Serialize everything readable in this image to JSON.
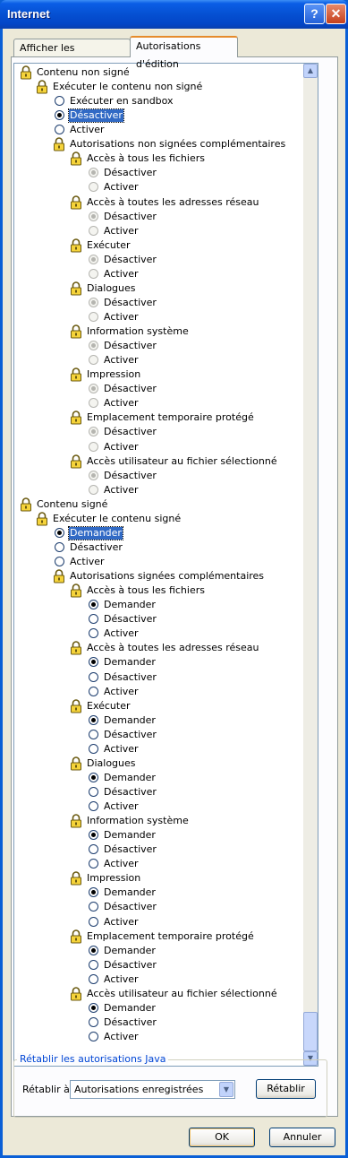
{
  "window": {
    "title": "Internet",
    "help_label": "?",
    "close_label": "✕"
  },
  "tabs": [
    {
      "label": "Afficher les autorisations",
      "active": false
    },
    {
      "label": "Autorisations d'édition",
      "active": true
    }
  ],
  "tree": [
    {
      "level": 0,
      "kind": "lock",
      "label": "Contenu non signé"
    },
    {
      "level": 1,
      "kind": "lock",
      "label": "Exécuter le contenu non signé"
    },
    {
      "level": 2,
      "kind": "radio",
      "label": "Exécuter en sandbox",
      "checked": false
    },
    {
      "level": 2,
      "kind": "radio",
      "label": "Désactiver",
      "checked": true,
      "selected": true
    },
    {
      "level": 2,
      "kind": "radio",
      "label": "Activer",
      "checked": false
    },
    {
      "level": 2,
      "kind": "lock",
      "label": "Autorisations non signées complémentaires"
    },
    {
      "level": 3,
      "kind": "lock",
      "label": "Accès à tous les fichiers"
    },
    {
      "level": 4,
      "kind": "radio",
      "label": "Désactiver",
      "checked": true,
      "disabled": true
    },
    {
      "level": 4,
      "kind": "radio",
      "label": "Activer",
      "checked": false,
      "disabled": true
    },
    {
      "level": 3,
      "kind": "lock",
      "label": "Accès à toutes les adresses réseau"
    },
    {
      "level": 4,
      "kind": "radio",
      "label": "Désactiver",
      "checked": true,
      "disabled": true
    },
    {
      "level": 4,
      "kind": "radio",
      "label": "Activer",
      "checked": false,
      "disabled": true
    },
    {
      "level": 3,
      "kind": "lock",
      "label": "Exécuter"
    },
    {
      "level": 4,
      "kind": "radio",
      "label": "Désactiver",
      "checked": true,
      "disabled": true
    },
    {
      "level": 4,
      "kind": "radio",
      "label": "Activer",
      "checked": false,
      "disabled": true
    },
    {
      "level": 3,
      "kind": "lock",
      "label": "Dialogues"
    },
    {
      "level": 4,
      "kind": "radio",
      "label": "Désactiver",
      "checked": true,
      "disabled": true
    },
    {
      "level": 4,
      "kind": "radio",
      "label": "Activer",
      "checked": false,
      "disabled": true
    },
    {
      "level": 3,
      "kind": "lock",
      "label": "Information système"
    },
    {
      "level": 4,
      "kind": "radio",
      "label": "Désactiver",
      "checked": true,
      "disabled": true
    },
    {
      "level": 4,
      "kind": "radio",
      "label": "Activer",
      "checked": false,
      "disabled": true
    },
    {
      "level": 3,
      "kind": "lock",
      "label": "Impression"
    },
    {
      "level": 4,
      "kind": "radio",
      "label": "Désactiver",
      "checked": true,
      "disabled": true
    },
    {
      "level": 4,
      "kind": "radio",
      "label": "Activer",
      "checked": false,
      "disabled": true
    },
    {
      "level": 3,
      "kind": "lock",
      "label": "Emplacement temporaire protégé"
    },
    {
      "level": 4,
      "kind": "radio",
      "label": "Désactiver",
      "checked": true,
      "disabled": true
    },
    {
      "level": 4,
      "kind": "radio",
      "label": "Activer",
      "checked": false,
      "disabled": true
    },
    {
      "level": 3,
      "kind": "lock",
      "label": "Accès utilisateur au fichier sélectionné"
    },
    {
      "level": 4,
      "kind": "radio",
      "label": "Désactiver",
      "checked": true,
      "disabled": true
    },
    {
      "level": 4,
      "kind": "radio",
      "label": "Activer",
      "checked": false,
      "disabled": true
    },
    {
      "level": 0,
      "kind": "lock",
      "label": "Contenu signé"
    },
    {
      "level": 1,
      "kind": "lock",
      "label": "Exécuter le contenu signé"
    },
    {
      "level": 2,
      "kind": "radio",
      "label": "Demander",
      "checked": true,
      "selected": true
    },
    {
      "level": 2,
      "kind": "radio",
      "label": "Désactiver",
      "checked": false
    },
    {
      "level": 2,
      "kind": "radio",
      "label": "Activer",
      "checked": false
    },
    {
      "level": 2,
      "kind": "lock",
      "label": "Autorisations signées complémentaires"
    },
    {
      "level": 3,
      "kind": "lock",
      "label": "Accès à tous les fichiers"
    },
    {
      "level": 4,
      "kind": "radio",
      "label": "Demander",
      "checked": true
    },
    {
      "level": 4,
      "kind": "radio",
      "label": "Désactiver",
      "checked": false
    },
    {
      "level": 4,
      "kind": "radio",
      "label": "Activer",
      "checked": false
    },
    {
      "level": 3,
      "kind": "lock",
      "label": "Accès à toutes les adresses réseau"
    },
    {
      "level": 4,
      "kind": "radio",
      "label": "Demander",
      "checked": true
    },
    {
      "level": 4,
      "kind": "radio",
      "label": "Désactiver",
      "checked": false
    },
    {
      "level": 4,
      "kind": "radio",
      "label": "Activer",
      "checked": false
    },
    {
      "level": 3,
      "kind": "lock",
      "label": "Exécuter"
    },
    {
      "level": 4,
      "kind": "radio",
      "label": "Demander",
      "checked": true
    },
    {
      "level": 4,
      "kind": "radio",
      "label": "Désactiver",
      "checked": false
    },
    {
      "level": 4,
      "kind": "radio",
      "label": "Activer",
      "checked": false
    },
    {
      "level": 3,
      "kind": "lock",
      "label": "Dialogues"
    },
    {
      "level": 4,
      "kind": "radio",
      "label": "Demander",
      "checked": true
    },
    {
      "level": 4,
      "kind": "radio",
      "label": "Désactiver",
      "checked": false
    },
    {
      "level": 4,
      "kind": "radio",
      "label": "Activer",
      "checked": false
    },
    {
      "level": 3,
      "kind": "lock",
      "label": "Information système"
    },
    {
      "level": 4,
      "kind": "radio",
      "label": "Demander",
      "checked": true
    },
    {
      "level": 4,
      "kind": "radio",
      "label": "Désactiver",
      "checked": false
    },
    {
      "level": 4,
      "kind": "radio",
      "label": "Activer",
      "checked": false
    },
    {
      "level": 3,
      "kind": "lock",
      "label": "Impression"
    },
    {
      "level": 4,
      "kind": "radio",
      "label": "Demander",
      "checked": true
    },
    {
      "level": 4,
      "kind": "radio",
      "label": "Désactiver",
      "checked": false
    },
    {
      "level": 4,
      "kind": "radio",
      "label": "Activer",
      "checked": false
    },
    {
      "level": 3,
      "kind": "lock",
      "label": "Emplacement temporaire protégé"
    },
    {
      "level": 4,
      "kind": "radio",
      "label": "Demander",
      "checked": true
    },
    {
      "level": 4,
      "kind": "radio",
      "label": "Désactiver",
      "checked": false
    },
    {
      "level": 4,
      "kind": "radio",
      "label": "Activer",
      "checked": false
    },
    {
      "level": 3,
      "kind": "lock",
      "label": "Accès utilisateur au fichier sélectionné"
    },
    {
      "level": 4,
      "kind": "radio",
      "label": "Demander",
      "checked": true
    },
    {
      "level": 4,
      "kind": "radio",
      "label": "Désactiver",
      "checked": false
    },
    {
      "level": 4,
      "kind": "radio",
      "label": "Activer",
      "checked": false
    }
  ],
  "reset_group": {
    "title": "Rétablir les autorisations Java",
    "reset_to_label": "Rétablir à",
    "combo_value": "Autorisations enregistrées",
    "reset_button": "Rétablir"
  },
  "footer": {
    "ok_label": "OK",
    "cancel_label": "Annuler"
  },
  "colors": {
    "selection": "#316ac5",
    "title_bar": "#0550d2",
    "group_title": "#0046d5"
  }
}
